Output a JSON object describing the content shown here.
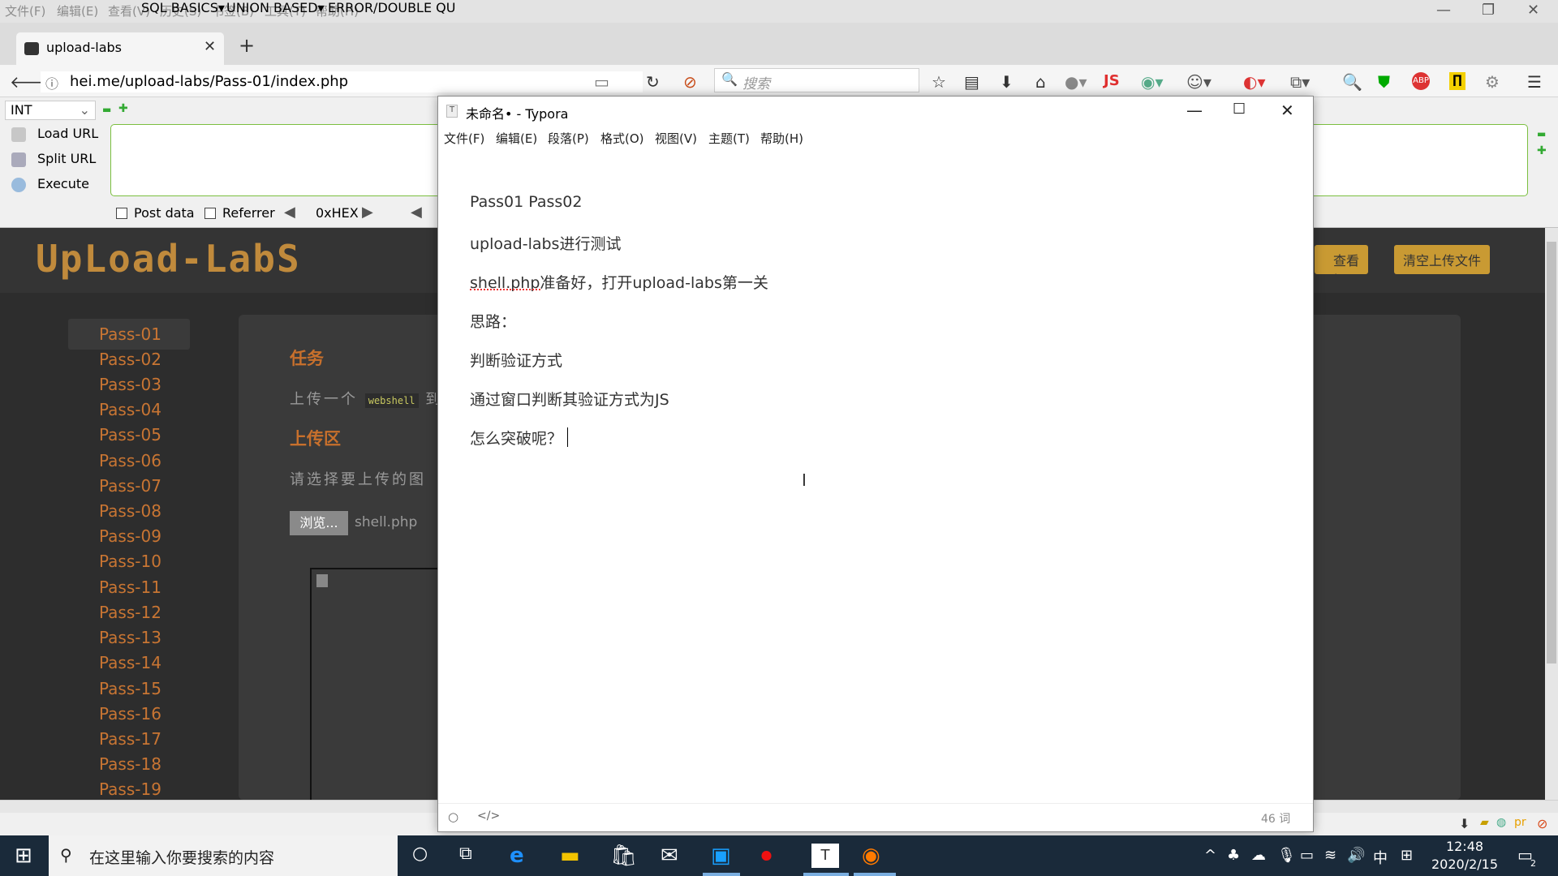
{
  "browser": {
    "menu": [
      "文件(F)",
      "编辑(E)",
      "查看(V)",
      "历史(S)",
      "书签(B)",
      "工具(T)",
      "帮助(H)"
    ],
    "tab_title": "upload-labs",
    "url": "hei.me/upload-labs/Pass-01/index.php",
    "search_placeholder": "搜索"
  },
  "hackbar": {
    "select_value": "INT",
    "menus": [
      "SQL BASICS▾",
      "UNION BASED▾",
      "ERROR/DOUBLE QU"
    ],
    "actions": [
      "Load URL",
      "Split URL",
      "Execute"
    ],
    "post_data_label": "Post data",
    "referrer_label": "Referrer",
    "hex_label": "0xHEX"
  },
  "page": {
    "logo": "UpLoad-LabS",
    "header_buttons": [
      "查看提示",
      "清空上传文件"
    ],
    "passes": [
      "Pass-01",
      "Pass-02",
      "Pass-03",
      "Pass-04",
      "Pass-05",
      "Pass-06",
      "Pass-07",
      "Pass-08",
      "Pass-09",
      "Pass-10",
      "Pass-11",
      "Pass-12",
      "Pass-13",
      "Pass-14",
      "Pass-15",
      "Pass-16",
      "Pass-17",
      "Pass-18",
      "Pass-19"
    ],
    "task_title": "任务",
    "task_text_prefix": "上传一个",
    "task_code": "webshell",
    "task_text_suffix": "到",
    "upload_title": "上传区",
    "upload_text": "请选择要上传的图",
    "browse_label": "浏览...",
    "file_name": "shell.php"
  },
  "typora": {
    "title": "未命名• - Typora",
    "menu": [
      "文件(F)",
      "编辑(E)",
      "段落(P)",
      "格式(O)",
      "视图(V)",
      "主题(T)",
      "帮助(H)"
    ],
    "lines": [
      "Pass01 Pass02",
      "upload-labs进行测试",
      "shell.php准备好，打开upload-labs第一关",
      "思路：",
      "判断验证方式",
      "通过窗口判断其验证方式为JS",
      "怎么突破呢？"
    ],
    "word_count": "46 词",
    "footer_code_icon": "</>"
  },
  "taskbar": {
    "search_text": "在这里输入你要搜索的内容",
    "time": "12:48",
    "date": "2020/2/15",
    "ime": "中",
    "notification_count": "2"
  }
}
